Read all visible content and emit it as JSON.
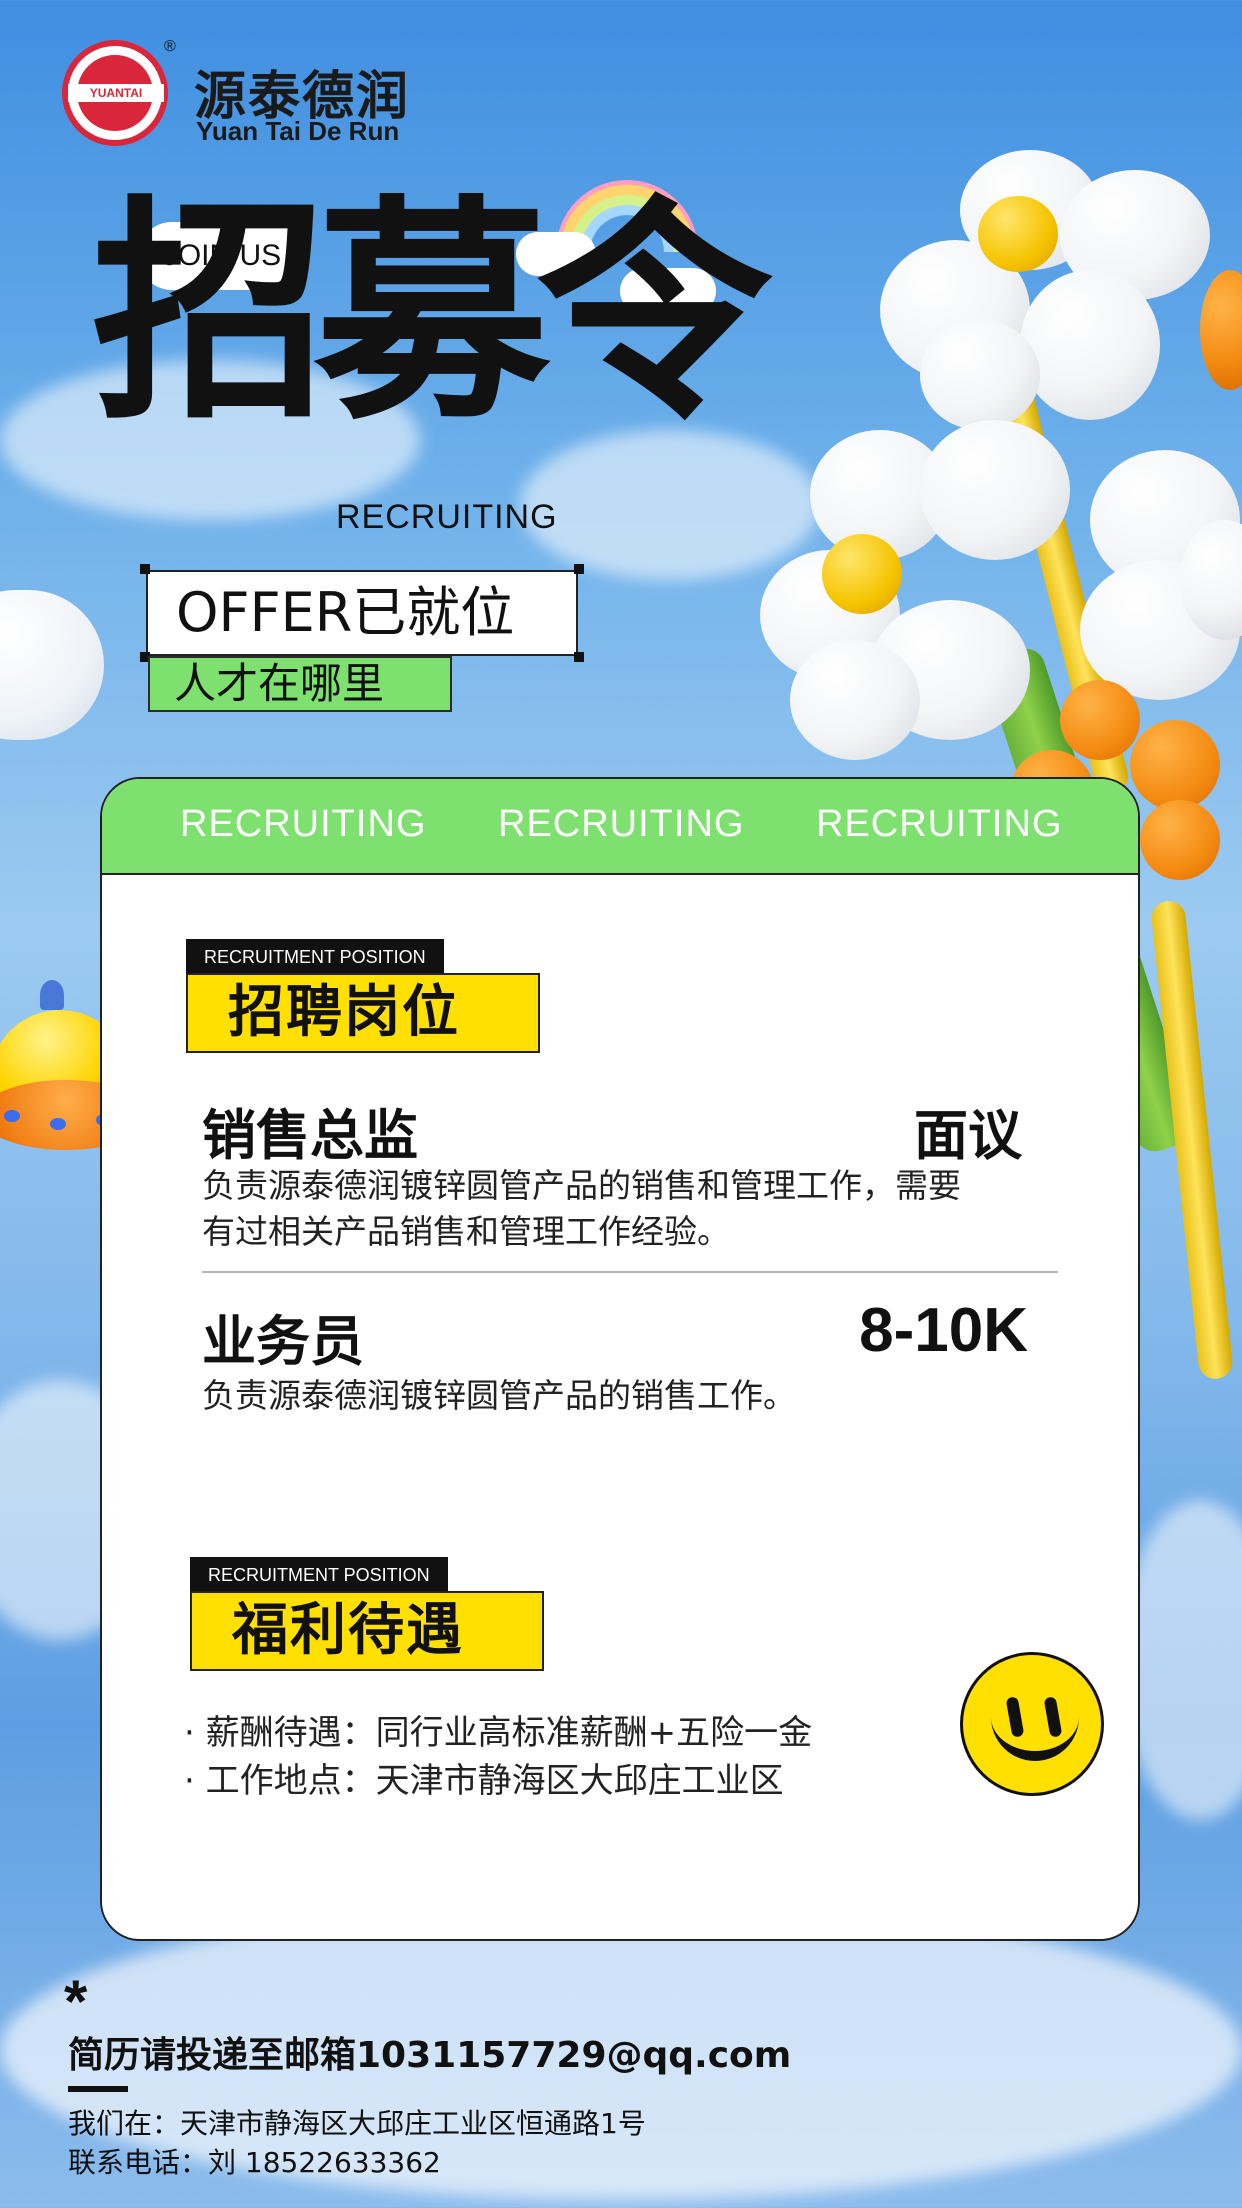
{
  "logo": {
    "mark_text": "YUANTAI",
    "registered": "®",
    "name_cn": "源泰德润",
    "name_en": "Yuan Tai De Run"
  },
  "hero": {
    "join": "JOIN US",
    "title": "招募令",
    "subtitle": "RECRUITING",
    "offer": "OFFER已就位",
    "talent": "人才在哪里"
  },
  "card": {
    "header_labels": [
      "RECRUITING",
      "RECRUITING",
      "RECRUITING"
    ],
    "positions": {
      "tag": "RECRUITMENT POSITION",
      "heading": "招聘岗位",
      "jobs": [
        {
          "title": "销售总监",
          "salary": "面议",
          "desc_line1": "负责源泰德润镀锌圆管产品的销售和管理工作，需要",
          "desc_line2": "有过相关产品销售和管理工作经验。"
        },
        {
          "title": "业务员",
          "salary": "8-10K",
          "desc_line1": "负责源泰德润镀锌圆管产品的销售工作。"
        }
      ]
    },
    "benefits": {
      "tag": "RECRUITMENT POSITION",
      "heading": "福利待遇",
      "items": [
        "· 薪酬待遇：同行业高标准薪酬+五险一金",
        "· 工作地点：天津市静海区大邱庄工业区"
      ]
    }
  },
  "footer": {
    "asterisk": "*",
    "email": "简历请投递至邮箱1031157729@qq.com",
    "address": "我们在：天津市静海区大邱庄工业区恒通路1号",
    "phone": "联系电话：刘 18522633362"
  },
  "colors": {
    "accent_green": "#7ee06e",
    "accent_yellow": "#ffe000",
    "logo_red": "#d9263a",
    "sky_blue": "#6aaeea"
  },
  "icons": [
    "logo-icon",
    "rainbow-icon",
    "flower-balloon-icon",
    "ufo-icon",
    "smiley-icon",
    "cloud-icon"
  ]
}
